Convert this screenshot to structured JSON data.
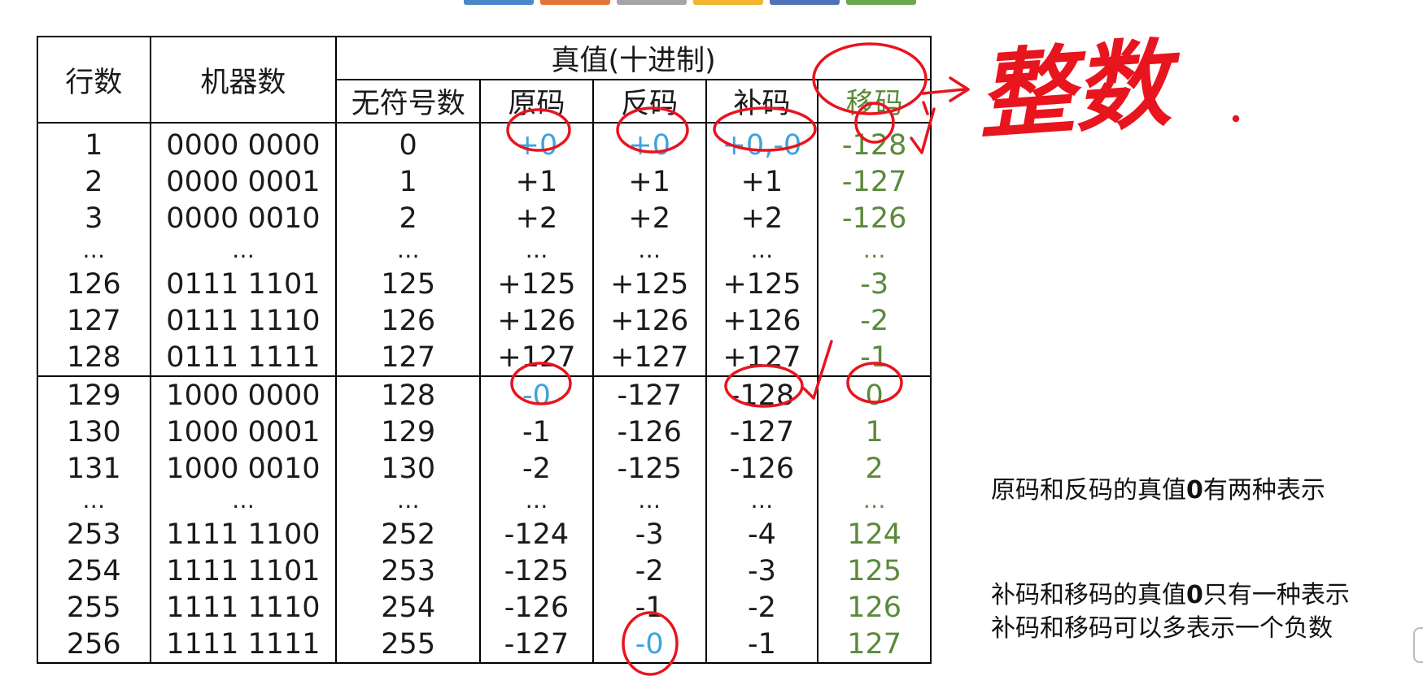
{
  "table": {
    "header": {
      "row_col": "行数",
      "machine_col": "机器数",
      "true_value_group": "真值(十进制)",
      "sub_cols": [
        "无符号数",
        "原码",
        "反码",
        "补码",
        "移码"
      ]
    },
    "rows": [
      [
        "1",
        "0000 0000",
        "0",
        "+0",
        "+0",
        "+0,-0",
        "-128"
      ],
      [
        "2",
        "0000 0001",
        "1",
        "+1",
        "+1",
        "+1",
        "-127"
      ],
      [
        "3",
        "0000 0010",
        "2",
        "+2",
        "+2",
        "+2",
        "-126"
      ],
      [
        "…",
        "…",
        "…",
        "…",
        "…",
        "…",
        "…"
      ],
      [
        "126",
        "0111 1101",
        "125",
        "+125",
        "+125",
        "+125",
        "-3"
      ],
      [
        "127",
        "0111 1110",
        "126",
        "+126",
        "+126",
        "+126",
        "-2"
      ],
      [
        "128",
        "0111 1111",
        "127",
        "+127",
        "+127",
        "+127",
        "-1"
      ],
      [
        "129",
        "1000 0000",
        "128",
        "-0",
        "-127",
        "-128",
        "0"
      ],
      [
        "130",
        "1000 0001",
        "129",
        "-1",
        "-126",
        "-127",
        "1"
      ],
      [
        "131",
        "1000 0010",
        "130",
        "-2",
        "-125",
        "-126",
        "2"
      ],
      [
        "…",
        "…",
        "…",
        "…",
        "…",
        "…",
        "…"
      ],
      [
        "253",
        "1111 1100",
        "252",
        "-124",
        "-3",
        "-4",
        "124"
      ],
      [
        "254",
        "1111 1101",
        "253",
        "-125",
        "-2",
        "-3",
        "125"
      ],
      [
        "255",
        "1111 1110",
        "254",
        "-126",
        "-1",
        "-2",
        "126"
      ],
      [
        "256",
        "1111 1111",
        "255",
        "-127",
        "-0",
        "-1",
        "127"
      ]
    ]
  },
  "handwriting": "整数",
  "notes": {
    "note1_pre": "原码和反码的真值",
    "note1_zero": "0",
    "note1_post": "有两种表示",
    "note2_pre": "补码和移码的真值",
    "note2_zero": "0",
    "note2_post": "只有一种表示",
    "note3": "补码和移码可以多表示一个负数"
  },
  "colors": {
    "highlight_blue": "#3ea3dc",
    "bias_green": "#5a8a3a",
    "ink_red": "#e8141e",
    "top_tabs": [
      "#4a86c8",
      "#e3743a",
      "#a5a5a5",
      "#f2b530",
      "#4f72b8",
      "#6aa84f"
    ]
  }
}
